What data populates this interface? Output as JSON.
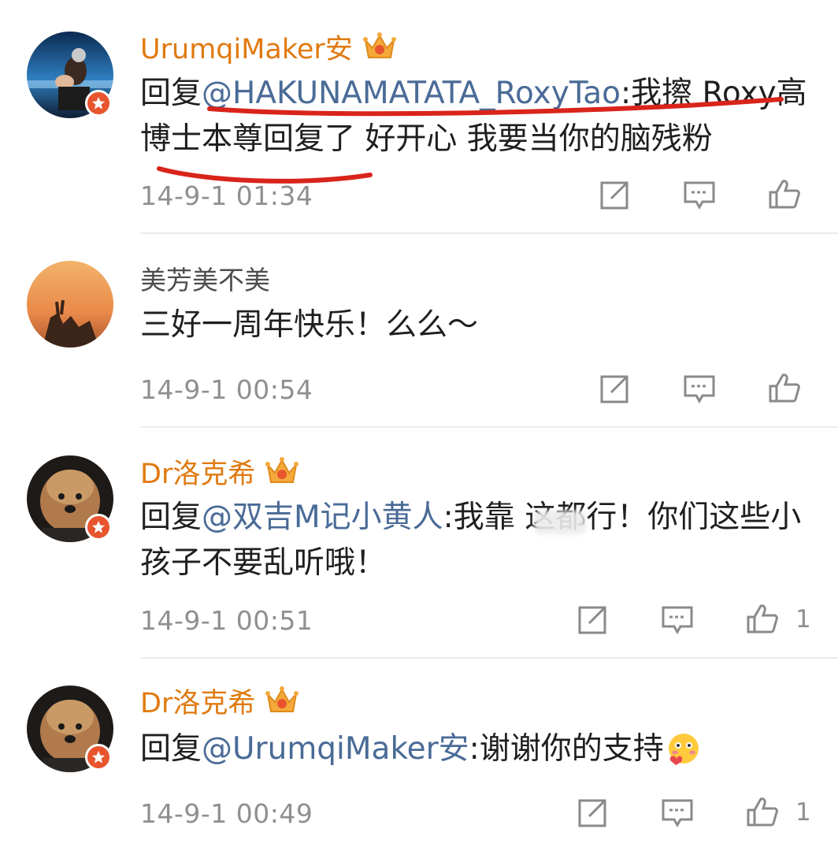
{
  "comments": [
    {
      "name": "UrumqiMaker安",
      "reply_prefix": "回复",
      "mention": "@HAKUNAMATATA_RoxyTao",
      "text": ":我擦 Roxy高博士本尊回复了 好开心 我要当你的脑残粉",
      "time": "14-9-1 01:34",
      "likes": ""
    },
    {
      "name": "美芳美不美",
      "text": "三好一周年快乐！么么～",
      "time": "14-9-1 00:54",
      "likes": ""
    },
    {
      "name": "Dr洛克希",
      "reply_prefix": "回复",
      "mention": "@双吉M记小黄人",
      "text": ":我靠    这都行！你们这些小孩子不要乱听哦！",
      "time": "14-9-1 00:51",
      "likes": "1"
    },
    {
      "name": "Dr洛克希",
      "reply_prefix": "回复",
      "mention": "@UrumqiMaker安",
      "text": ":谢谢你的支持",
      "time": "14-9-1 00:49",
      "likes": "1"
    }
  ],
  "colors": {
    "vip_name": "#e07a10",
    "mention": "#4a6b97",
    "verified_badge": "#e8542d",
    "annotation": "#d9241b"
  },
  "icons": [
    "share-icon",
    "comment-icon",
    "like-icon",
    "crown-icon",
    "emoji-shy-icon"
  ]
}
